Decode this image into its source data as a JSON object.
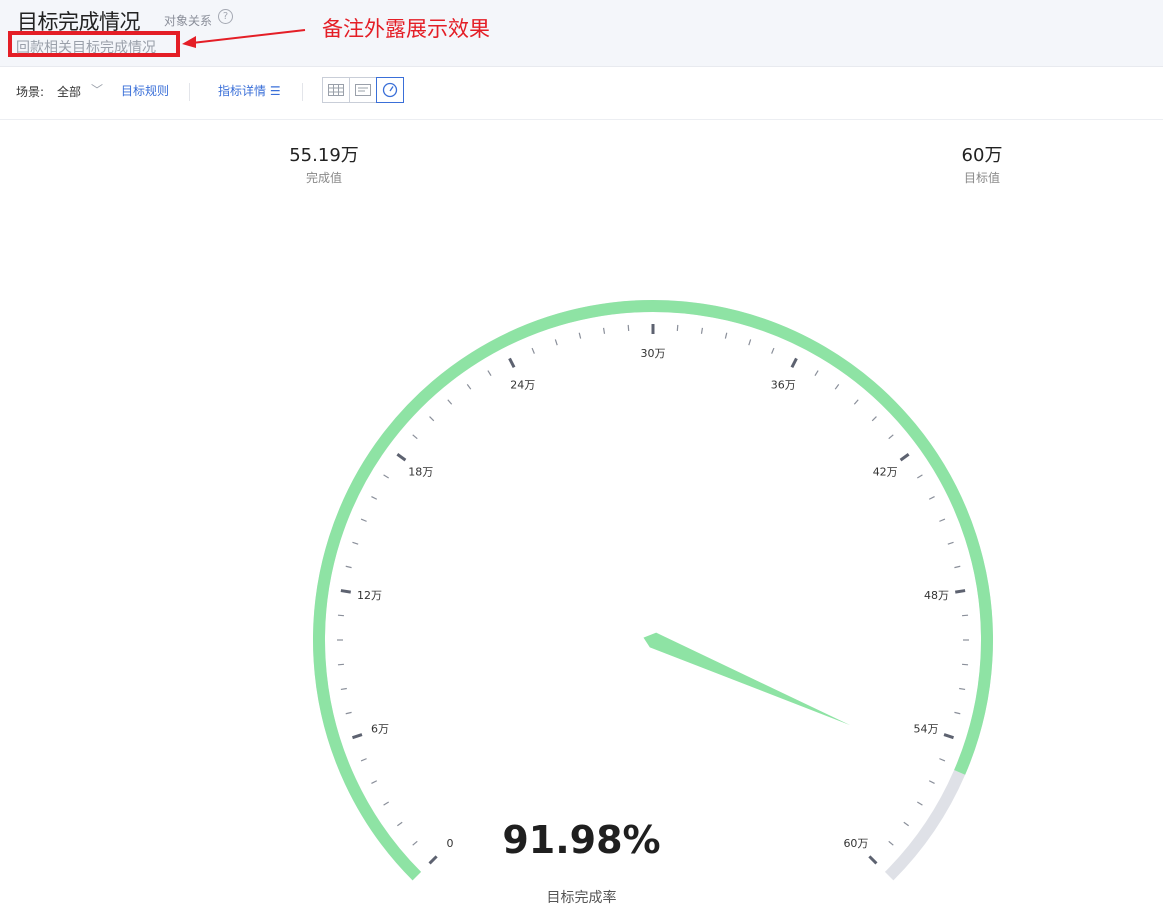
{
  "header": {
    "title": "目标完成情况",
    "relation_link": "对象关系",
    "help_icon": "question-circle-icon",
    "remark": "回款相关目标完成情况",
    "annotation": "备注外露展示效果",
    "annotation_color": "#e41e26"
  },
  "toolbar": {
    "scene_label": "场景:",
    "scene_value": "全部",
    "rules_link": "目标规则",
    "detail_link": "指标详情",
    "detail_icon": "list-icon",
    "views": [
      {
        "icon": "table-view-icon",
        "active": false
      },
      {
        "icon": "card-view-icon",
        "active": false
      },
      {
        "icon": "gauge-view-icon",
        "active": true
      }
    ]
  },
  "stats": {
    "completed_value": "55.19万",
    "completed_label": "完成值",
    "target_value": "60万",
    "target_label": "目标值"
  },
  "chart_data": {
    "type": "gauge",
    "min": 0,
    "max": 60,
    "unit": "万",
    "value": 55.19,
    "target": 60,
    "ticks": [
      "0",
      "6万",
      "12万",
      "18万",
      "24万",
      "30万",
      "36万",
      "42万",
      "48万",
      "54万",
      "60万"
    ],
    "percent_label": "91.98%",
    "caption": "目标完成率",
    "progress_color": "#8ee3a4",
    "track_color": "#dfe1e7"
  }
}
